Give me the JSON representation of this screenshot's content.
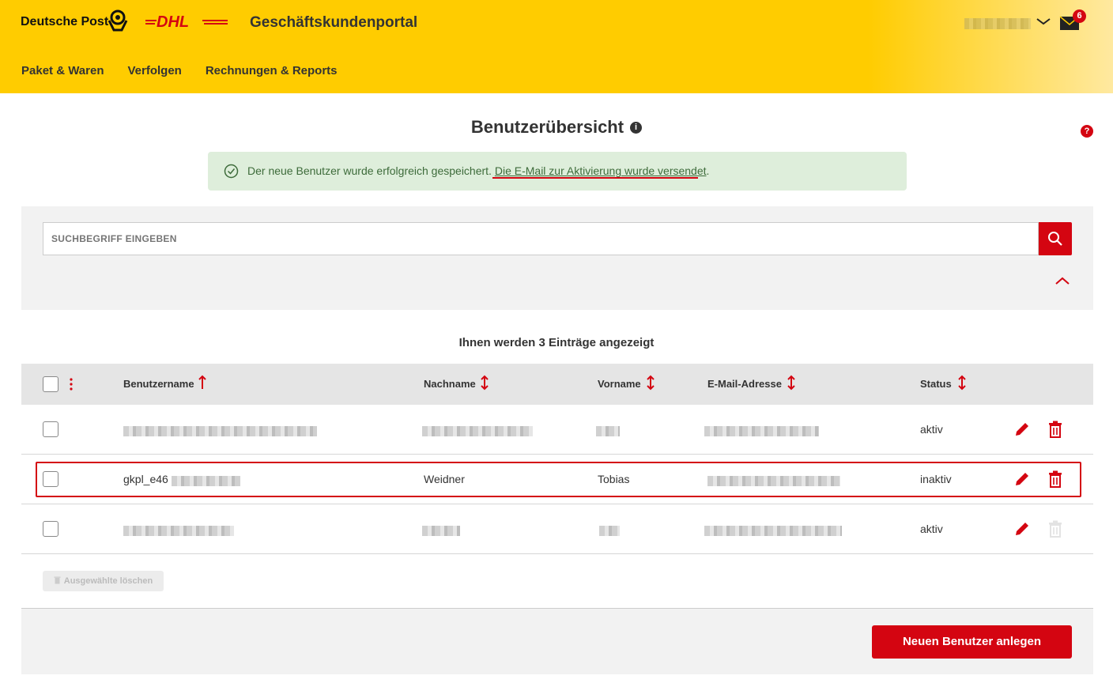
{
  "header": {
    "brand": "Deutsche Post",
    "logo_dhl": "DHL",
    "portal_title": "Geschäftskundenportal",
    "mail_badge": "6",
    "brand_color": "#ffcc00",
    "accent_color": "#d40511"
  },
  "nav": {
    "items": [
      {
        "label": "Paket & Waren"
      },
      {
        "label": "Verfolgen"
      },
      {
        "label": "Rechnungen & Reports"
      }
    ]
  },
  "page": {
    "title": "Benutzerübersicht",
    "info_icon": "i",
    "help_icon": "?"
  },
  "success": {
    "text": "Der neue Benutzer wurde erfolgreich gespeichert. ",
    "link_text": "Die E-Mail zur Aktivierung wurde versendet",
    "suffix": "."
  },
  "search": {
    "placeholder": "SUCHBEGRIFF EINGEBEN"
  },
  "table": {
    "count_text": "Ihnen werden 3 Einträge angezeigt",
    "columns": {
      "username": "Benutzername",
      "lastname": "Nachname",
      "firstname": "Vorname",
      "email": "E-Mail-Adresse",
      "status": "Status"
    },
    "rows": [
      {
        "username": "",
        "lastname": "",
        "firstname": "",
        "email": "",
        "status": "aktiv"
      },
      {
        "username": "gkpl_e46",
        "lastname": "Weidner",
        "firstname": "Tobias",
        "email": "",
        "status": "inaktiv"
      },
      {
        "username": "",
        "lastname": "",
        "firstname": "",
        "email": "",
        "status": "aktiv"
      }
    ]
  },
  "actions": {
    "bulk_delete": "Ausgewählte löschen",
    "new_user": "Neuen Benutzer anlegen"
  }
}
